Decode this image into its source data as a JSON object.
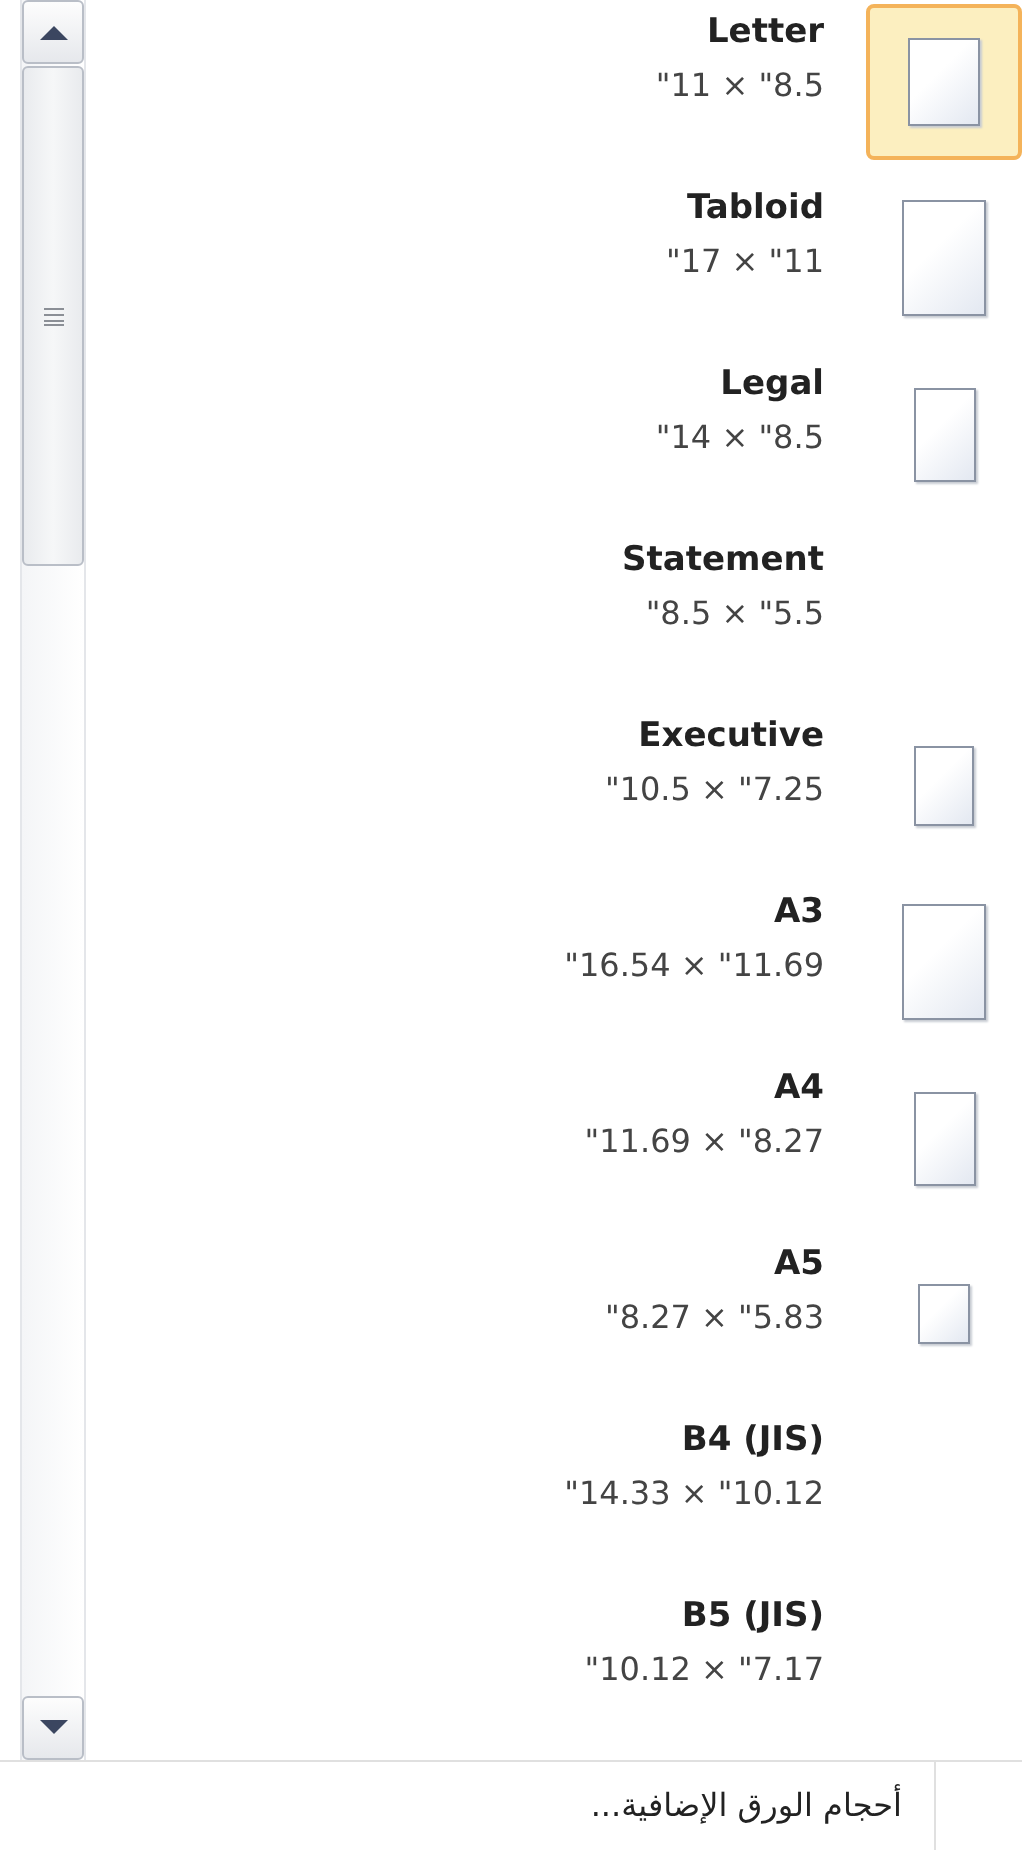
{
  "paper_sizes": [
    {
      "name": "Letter",
      "size": "\"11 × \"8.5",
      "kind": "medium",
      "selected": true
    },
    {
      "name": "Tabloid",
      "size": "\"17 × \"11",
      "kind": "large",
      "selected": false
    },
    {
      "name": "Legal",
      "size": "\"14 × \"8.5",
      "kind": "narrow",
      "selected": false
    },
    {
      "name": "Statement",
      "size": "\"8.5 × \"5.5",
      "kind": "plain",
      "selected": false
    },
    {
      "name": "Executive",
      "size": "\"10.5 × \"7.25",
      "kind": "small",
      "selected": false
    },
    {
      "name": "A3",
      "size": "\"16.54 × \"11.69",
      "kind": "large",
      "selected": false
    },
    {
      "name": "A4",
      "size": "\"11.69 × \"8.27",
      "kind": "narrow",
      "selected": false
    },
    {
      "name": "A5",
      "size": "\"8.27 × \"5.83",
      "kind": "tiny",
      "selected": false
    },
    {
      "name": "B4 (JIS)",
      "size": "\"14.33 × \"10.12",
      "kind": "plain",
      "selected": false
    },
    {
      "name": "B5 (JIS)",
      "size": "\"10.12 × \"7.17",
      "kind": "plain",
      "selected": false
    }
  ],
  "more_link": "أحجام الورق الإضافية..."
}
